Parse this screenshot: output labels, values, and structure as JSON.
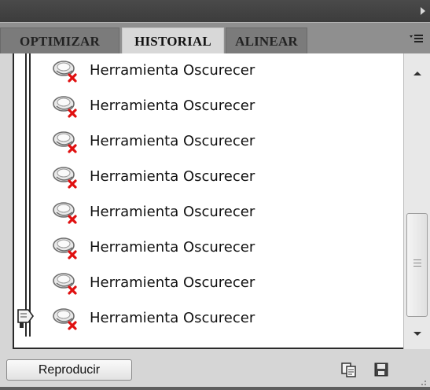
{
  "tabs": [
    {
      "label": "OPTIMIZAR",
      "active": false
    },
    {
      "label": "HISTORIAL",
      "active": true
    },
    {
      "label": "ALINEAR",
      "active": false
    }
  ],
  "panel_menu_icon": "panel-menu-icon",
  "history": {
    "items": [
      {
        "label": "Herramienta Oscurecer",
        "icon": "burn-tool-icon"
      },
      {
        "label": "Herramienta Oscurecer",
        "icon": "burn-tool-icon"
      },
      {
        "label": "Herramienta Oscurecer",
        "icon": "burn-tool-icon"
      },
      {
        "label": "Herramienta Oscurecer",
        "icon": "burn-tool-icon"
      },
      {
        "label": "Herramienta Oscurecer",
        "icon": "burn-tool-icon"
      },
      {
        "label": "Herramienta Oscurecer",
        "icon": "burn-tool-icon"
      },
      {
        "label": "Herramienta Oscurecer",
        "icon": "burn-tool-icon"
      },
      {
        "label": "Herramienta Oscurecer",
        "icon": "burn-tool-icon"
      }
    ],
    "current_index": 7
  },
  "footer": {
    "play_label": "Reproducir",
    "icons": [
      "copy-icon",
      "save-icon"
    ]
  },
  "colors": {
    "delete_mark": "#e01010",
    "panel_bg": "#d6d6d6",
    "tab_bar": "#8f8f8f"
  }
}
